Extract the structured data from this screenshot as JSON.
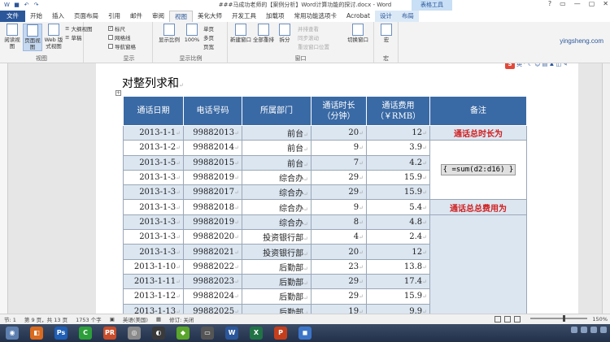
{
  "window": {
    "title": "###马成功老师的【案例分析】Word计算功能的探讨.docx - Word",
    "context_tab_group": "表格工具",
    "controls": [
      "?",
      "▭",
      "—",
      "▢",
      "✕"
    ]
  },
  "tabs": [
    "文件",
    "开始",
    "插入",
    "页面布局",
    "引用",
    "邮件",
    "审阅",
    "视图",
    "美化大师",
    "开发工具",
    "加载项",
    "常用功能选项卡",
    "Acrobat",
    "设计",
    "布局"
  ],
  "ribbon": {
    "views": {
      "read": "阅读视图",
      "print": "页面视图",
      "web": "Web 版式视图",
      "outline": "大纲视图",
      "draft": "草稿",
      "label": "视图"
    },
    "show": {
      "ruler": "标尺",
      "gridlines": "网格线",
      "nav": "导航窗格",
      "label": "显示"
    },
    "zoom": {
      "zoom": "显示比例",
      "100": "100%",
      "one_page": "单页",
      "multi_page": "多页",
      "page_width": "页宽",
      "label": "显示比例"
    },
    "window": {
      "new": "新建窗口",
      "arrange": "全部重排",
      "split": "拆分",
      "side": "并排查看",
      "sync": "同步滚动",
      "reset": "重设窗口位置",
      "switch": "切换窗口",
      "label": "窗口"
    },
    "macro": {
      "macro": "宏",
      "label": "宏"
    },
    "brand": "yingsheng.com"
  },
  "ime": {
    "logo": "S",
    "mode": "英"
  },
  "document": {
    "heading": "对整列求和",
    "headers": [
      "通话日期",
      "电话号码",
      "所属部门",
      "通话时长\n（分钟）",
      "通话费用\n（￥RMB）",
      "备注"
    ],
    "rows": [
      [
        "2013-1-1",
        "99882013",
        "前台",
        "20",
        "12"
      ],
      [
        "2013-1-2",
        "99882014",
        "前台",
        "9",
        "3.9"
      ],
      [
        "2013-1-5",
        "99882015",
        "前台",
        "7",
        "4.2"
      ],
      [
        "2013-1-3",
        "99882019",
        "综合办",
        "29",
        "15.9"
      ],
      [
        "2013-1-3",
        "99882017",
        "综合办",
        "29",
        "15.9"
      ],
      [
        "2013-1-3",
        "99882018",
        "综合办",
        "9",
        "5.4"
      ],
      [
        "2013-1-3",
        "99882019",
        "综合办",
        "8",
        "4.8"
      ],
      [
        "2013-1-3",
        "99882020",
        "投资银行部",
        "4",
        "2.4"
      ],
      [
        "2013-1-3",
        "99882021",
        "投资银行部",
        "20",
        "12"
      ],
      [
        "2013-1-10",
        "99882022",
        "后勤部",
        "23",
        "13.8"
      ],
      [
        "2013-1-11",
        "99882023",
        "后勤部",
        "29",
        "17.4"
      ],
      [
        "2013-1-12",
        "99882024",
        "后勤部",
        "29",
        "15.9"
      ],
      [
        "2013-1-13",
        "99882025",
        "后勤部",
        "19",
        "9.9"
      ]
    ],
    "remark_total_duration": "通话总时长为",
    "field_code": "{ =sum(d2:d16) }",
    "remark_total_cost": "通话总总费用为"
  },
  "status": {
    "section": "节: 1",
    "page": "第 9 页，共 13 页",
    "words": "1753 个字",
    "lang": "英语(美国)",
    "track": "修订: 关闭",
    "zoom": "150%",
    "zoom_fraction": 0.6
  },
  "taskbar": [
    "Ps",
    "C",
    "PR",
    "W",
    "X",
    "P"
  ]
}
